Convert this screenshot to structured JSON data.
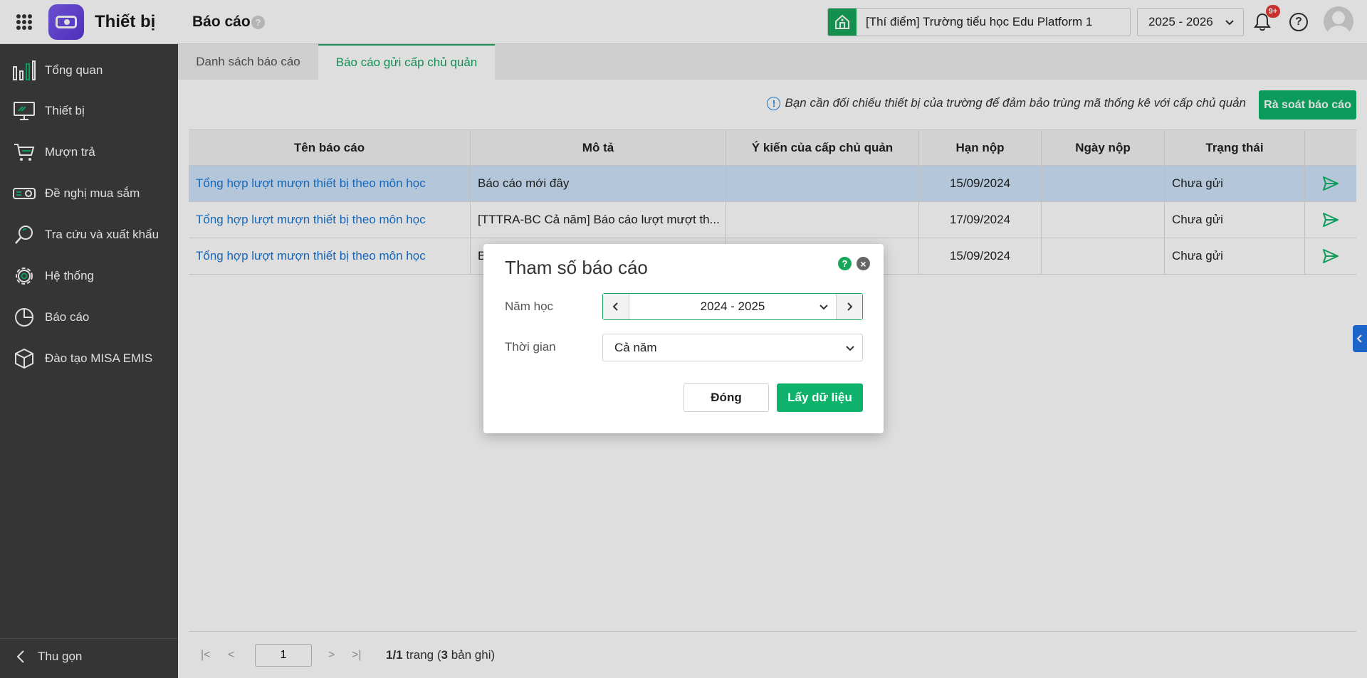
{
  "app": {
    "name": "Thiết bị",
    "page_title": "Báo cáo",
    "page_help": "?"
  },
  "header": {
    "school": "[Thí điểm] Trường tiểu học Edu Platform 1",
    "year": "2025 - 2026",
    "notification_badge": "9+",
    "help": "?"
  },
  "sidebar": {
    "items": [
      {
        "label": "Tổng quan",
        "icon": "bar-chart-icon"
      },
      {
        "label": "Thiết bị",
        "icon": "monitor-icon"
      },
      {
        "label": "Mượn trả",
        "icon": "cart-icon"
      },
      {
        "label": "Đề nghị mua sắm",
        "icon": "projector-icon"
      },
      {
        "label": "Tra cứu và xuất khẩu",
        "icon": "search-icon"
      },
      {
        "label": "Hệ thống",
        "icon": "gear-icon"
      },
      {
        "label": "Báo cáo",
        "icon": "pie-chart-icon"
      },
      {
        "label": "Đào tạo MISA EMIS",
        "icon": "cube-icon"
      }
    ],
    "collapse_label": "Thu gọn"
  },
  "tabs": [
    {
      "label": "Danh sách báo cáo",
      "active": false
    },
    {
      "label": "Báo cáo gửi cấp chủ quản",
      "active": true
    }
  ],
  "notice": "Bạn cần đối chiếu thiết bị của trường để đảm bảo trùng mã thống kê với cấp chủ quản",
  "review_button": "Rà soát báo cáo",
  "table": {
    "headers": [
      "Tên báo cáo",
      "Mô tả",
      "Ý kiến của cấp chủ quản",
      "Hạn nộp",
      "Ngày nộp",
      "Trạng thái",
      ""
    ],
    "rows": [
      {
        "name": "Tổng hợp lượt mượn thiết bị theo môn học",
        "desc": "Báo cáo mới đây",
        "opinion": "",
        "due": "15/09/2024",
        "submitted": "",
        "status": "Chưa gửi",
        "selected": true
      },
      {
        "name": "Tổng hợp lượt mượn thiết bị theo môn học",
        "desc": "[TTTRA-BC Cả năm] Báo cáo lượt mượt th...",
        "opinion": "",
        "due": "17/09/2024",
        "submitted": "",
        "status": "Chưa gửi",
        "selected": false
      },
      {
        "name": "Tổng hợp lượt mượn thiết bị theo môn học",
        "desc": "B",
        "opinion": "",
        "due": "15/09/2024",
        "submitted": "",
        "status": "Chưa gửi",
        "selected": false
      }
    ]
  },
  "pager": {
    "page": "1",
    "current": "1/1",
    "trang": " trang (",
    "count": "3",
    "suffix": " bản ghi)"
  },
  "dialog": {
    "title": "Tham số báo cáo",
    "help": "?",
    "close": "×",
    "year_label": "Năm học",
    "year_value": "2024 - 2025",
    "period_label": "Thời gian",
    "period_value": "Cả năm",
    "cancel": "Đóng",
    "submit": "Lấy dữ liệu"
  },
  "colors": {
    "accent": "#0fb26a",
    "sidebar": "#3d3d3d",
    "link": "#1976d2",
    "selected_row": "#cfe5fb"
  }
}
